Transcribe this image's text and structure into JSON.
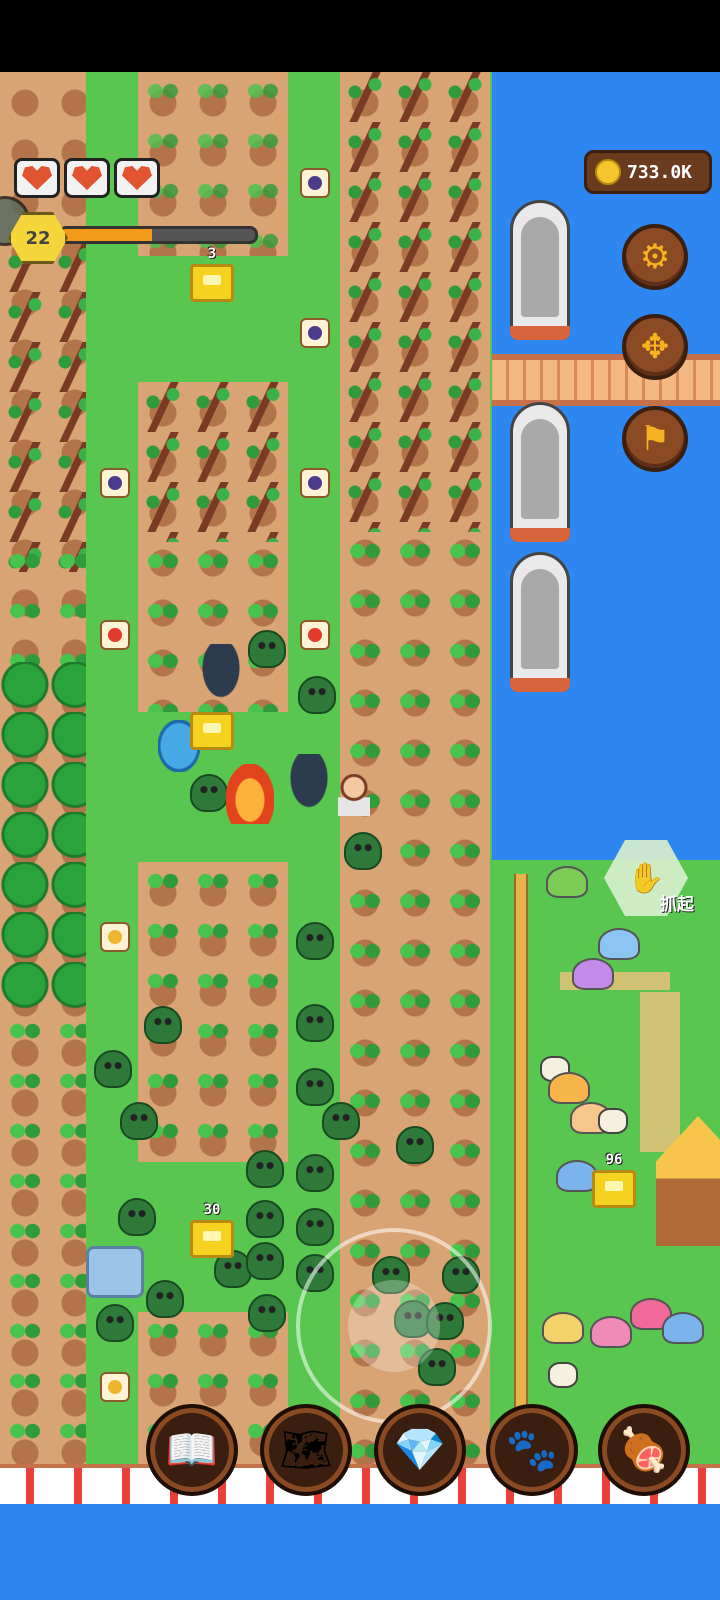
{
  "hud": {
    "hearts": [
      {
        "name": "heart-1",
        "filled": true
      },
      {
        "name": "heart-2",
        "filled": true
      },
      {
        "name": "heart-3",
        "filled": true
      }
    ],
    "level": "22",
    "xp_progress": 0.47,
    "coins": "733.0K"
  },
  "side_buttons": [
    {
      "icon": "gear-icon",
      "glyph": "⚙",
      "label": "settings"
    },
    {
      "icon": "move-arrows-icon",
      "glyph": "✥",
      "label": "move"
    },
    {
      "icon": "flag-icon",
      "glyph": "⚑",
      "label": "flag"
    }
  ],
  "grab": {
    "label": "抓起",
    "icon": "glove-icon"
  },
  "chests": [
    {
      "count": "3"
    },
    {
      "count": ""
    },
    {
      "count": "30"
    },
    {
      "count": "96"
    }
  ],
  "dock": [
    {
      "icon": "book-icon",
      "glyph": "📖"
    },
    {
      "icon": "map-scroll-icon",
      "glyph": "🗺"
    },
    {
      "icon": "diamond-coin-icon",
      "glyph": "💎"
    },
    {
      "icon": "paw-icon",
      "glyph": "🐾"
    },
    {
      "icon": "meat-icon",
      "glyph": "🍖"
    }
  ],
  "colors": {
    "grass": "#59c74f",
    "soil": "#d9a474",
    "sea": "#2e86f0",
    "xp": "#f39a1b",
    "coin_panel": "#6b3b1f"
  }
}
